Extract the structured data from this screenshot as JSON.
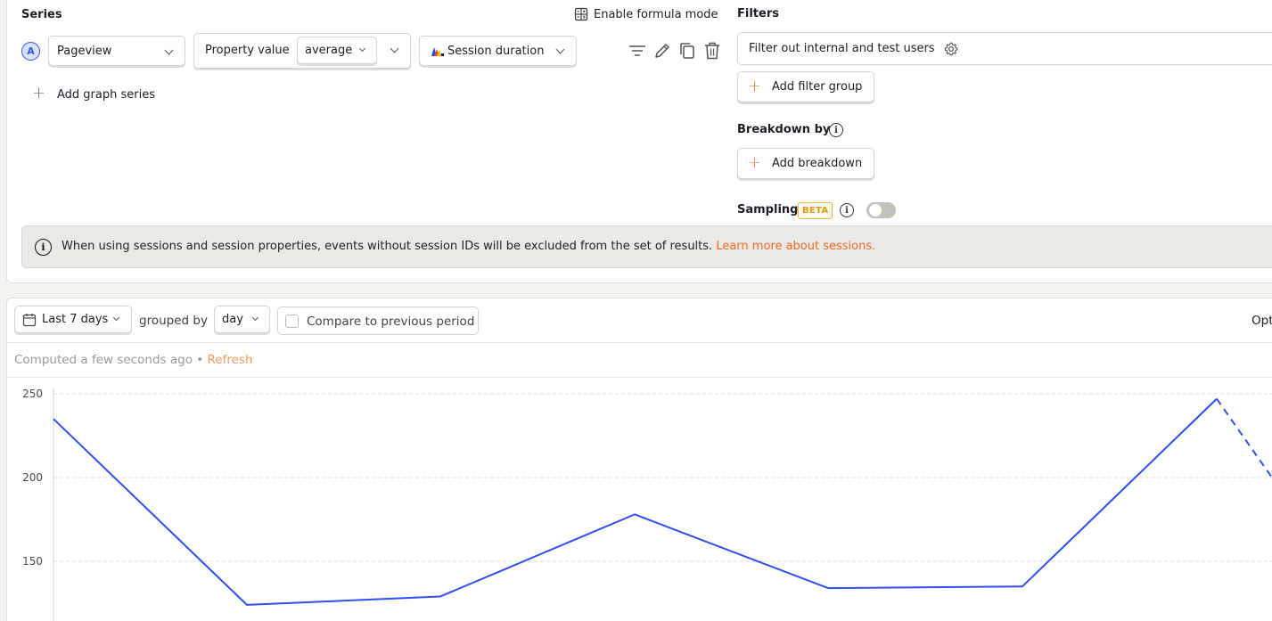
{
  "series": {
    "title": "Series",
    "formula_mode_label": "Enable formula mode",
    "badge": "A",
    "event": "Pageview",
    "aggregation_label": "Property value",
    "aggregation_value": "average",
    "property": "Session duration",
    "add_series_label": "Add graph series"
  },
  "filters": {
    "title": "Filters",
    "internal_filter_label": "Filter out internal and test users",
    "add_filter_group_label": "Add filter group"
  },
  "breakdown": {
    "title": "Breakdown by",
    "add_breakdown_label": "Add breakdown"
  },
  "sampling": {
    "title": "Sampling",
    "badge": "BETA",
    "enabled": false
  },
  "notice": {
    "text": "When using sessions and session properties, events without session IDs will be excluded from the set of results.",
    "link_text": "Learn more about sessions."
  },
  "toolbar": {
    "date_range": "Last 7 days",
    "grouped_by_label": "grouped by",
    "interval": "day",
    "compare_label": "Compare to previous period",
    "options_label": "Opt"
  },
  "status": {
    "computed_text": "Computed a few seconds ago",
    "separator": "•",
    "refresh_label": "Refresh"
  },
  "icons": {
    "filter": "filter-lines-icon",
    "edit": "pencil-icon",
    "duplicate": "copy-icon",
    "delete": "trash-icon",
    "formula": "calculator-icon",
    "calendar": "calendar-icon",
    "info": "info-icon",
    "settings": "gear-icon"
  },
  "colors": {
    "series_line": "#2f4ff0",
    "accent_orange": "#eb6a2a",
    "beta_yellow": "#f5b53a"
  },
  "chart_data": {
    "type": "line",
    "y_ticks": [
      250,
      200,
      150
    ],
    "ylim": [
      118,
      250
    ],
    "grid": true,
    "series": [
      {
        "values": [
          235,
          124,
          129,
          178,
          134,
          135,
          247,
          200
        ],
        "dashed_from_index": 6
      }
    ]
  }
}
